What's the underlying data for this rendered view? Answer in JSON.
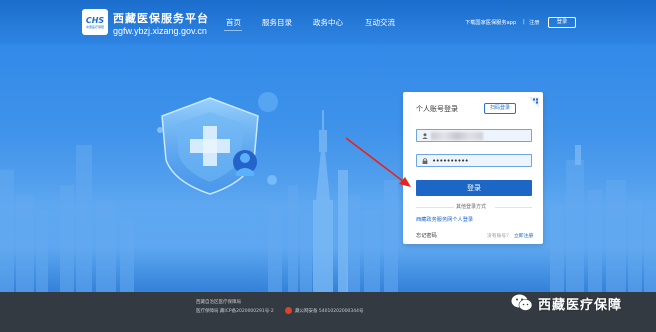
{
  "header": {
    "logo_text": "CHS",
    "logo_subtext": "中国医疗保障",
    "site_name": "西藏医保服务平台",
    "site_domain": "ggfw.ybzj.xizang.gov.cn",
    "nav": [
      "首页",
      "服务目录",
      "政务中心",
      "互动交流"
    ],
    "download_app": "下载国家医保服务app",
    "separator": "|",
    "register": "注册",
    "login": "登录"
  },
  "login_panel": {
    "title": "个人账号登录",
    "scan_login": "扫码登录",
    "username_value": "",
    "password_value": "••••••••••",
    "login_button": "登录",
    "other_methods": "其他登录方式",
    "gov_login": "西藏政务服务网个人登录",
    "forgot_password": "忘记密码",
    "no_account": "没有账号？",
    "register_now": "立即注册"
  },
  "footer": {
    "line1": "西藏自治区医疗保障局",
    "line2": "医疗保障局 藏ICP备2020000291号-2",
    "line3": "藏公网安备 54010202000344号"
  },
  "watermark": {
    "text": "西藏医疗保障"
  },
  "colors": {
    "header_blue": "#1b6dcc",
    "primary_button": "#1c66c6",
    "footer_bg": "#343a41",
    "arrow_red": "#e8231b"
  },
  "icons": {
    "user": "user-icon",
    "lock": "lock-icon",
    "qr": "qr-code-icon",
    "shield": "shield-cross-illustration",
    "wechat": "wechat-watermark-icon"
  }
}
